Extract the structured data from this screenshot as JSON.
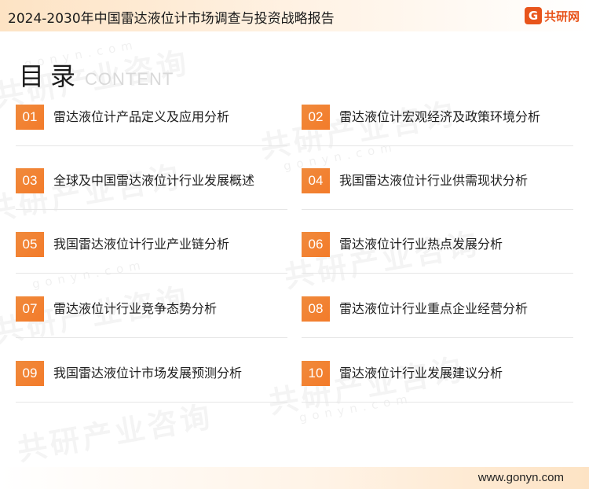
{
  "header": {
    "title": "2024-2030年中国雷达液位计市场调查与投资战略报告",
    "logo_mark": "G",
    "logo_text": "共研网"
  },
  "heading": {
    "cn": "目录",
    "en": "CONTENT"
  },
  "watermark": {
    "brand": "共研产业咨询",
    "url": "gonyn.com"
  },
  "toc": [
    {
      "num": "01",
      "label": "雷达液位计产品定义及应用分析"
    },
    {
      "num": "02",
      "label": "雷达液位计宏观经济及政策环境分析"
    },
    {
      "num": "03",
      "label": "全球及中国雷达液位计行业发展概述"
    },
    {
      "num": "04",
      "label": "我国雷达液位计行业供需现状分析"
    },
    {
      "num": "05",
      "label": "我国雷达液位计行业产业链分析"
    },
    {
      "num": "06",
      "label": "雷达液位计行业热点发展分析"
    },
    {
      "num": "07",
      "label": "雷达液位计行业竞争态势分析"
    },
    {
      "num": "08",
      "label": "雷达液位计行业重点企业经营分析"
    },
    {
      "num": "09",
      "label": "我国雷达液位计市场发展预测分析"
    },
    {
      "num": "10",
      "label": "雷达液位计行业发展建议分析"
    }
  ],
  "footer": {
    "url": "www.gonyn.com"
  },
  "colors": {
    "accent": "#f37b2a",
    "logo": "#e8541b"
  }
}
